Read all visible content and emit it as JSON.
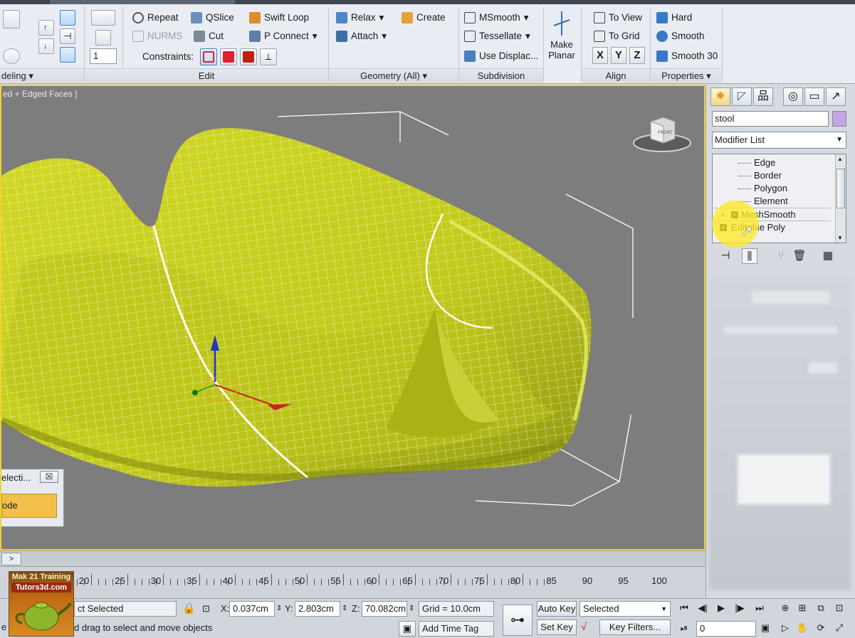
{
  "ribbon": {
    "mode_tab": "deling",
    "groups": {
      "edit": "Edit",
      "geometry": "Geometry (All)",
      "subdivision": "Subdivision",
      "align": "Align",
      "properties": "Properties"
    },
    "edit": {
      "repeat": "Repeat",
      "qslice": "QSlice",
      "swift_loop": "Swift Loop",
      "nurms": "NURMS",
      "cut": "Cut",
      "p_connect": "P Connect",
      "constraints": "Constraints:"
    },
    "geometry": {
      "relax": "Relax",
      "create": "Create",
      "attach": "Attach"
    },
    "subdivision": {
      "msmooth": "MSmooth",
      "tessellate": "Tessellate",
      "use_displac": "Use Displac..."
    },
    "make_planar": "Make Planar",
    "make_planar_l1": "Make",
    "make_planar_l2": "Planar",
    "align": {
      "to_view": "To View",
      "to_grid": "To Grid",
      "x": "X",
      "y": "Y",
      "z": "Z"
    },
    "properties": {
      "hard": "Hard",
      "smooth": "Smooth",
      "smooth30": "Smooth 30"
    },
    "spinner_value": "1"
  },
  "viewport": {
    "label": "ed + Edged Faces ]",
    "viewcube_face": "FRONT"
  },
  "selection_panel": {
    "title": "electi...",
    "close": "☒",
    "mode": "ode"
  },
  "command_panel": {
    "object_name": "stool",
    "object_color": "#c7a6e8",
    "modifier_list": "Modifier List",
    "subobjects": [
      "Edge",
      "Border",
      "Polygon",
      "Element"
    ],
    "modifiers": [
      "MeshSmooth",
      "Editable Poly"
    ],
    "highlight_color": "#ffeb28"
  },
  "timeline": {
    "next_button": ">",
    "ticks": [
      "20",
      "25",
      "30",
      "35",
      "40",
      "45",
      "50",
      "55",
      "60",
      "65",
      "70",
      "75",
      "80",
      "85",
      "90",
      "95",
      "100"
    ]
  },
  "status": {
    "selection": "ct Selected",
    "prompt": "d drag to select and move objects",
    "x_label": "X:",
    "x_value": "0.037cm",
    "y_label": "Y:",
    "y_value": "2.803cm",
    "z_label": "Z:",
    "z_value": "70.082cm",
    "grid": "Grid = 10.0cm",
    "add_time_tag": "Add Time Tag",
    "auto_key": "Auto Key",
    "set_key": "Set Key",
    "key_mode": "Selected",
    "key_filters": "Key Filters...",
    "frame": "0",
    "left_edge": "e"
  },
  "logo": {
    "line1": "Mak 21 Training",
    "line2": "Tutors3d.com"
  },
  "colors": {
    "accent": "#f0d234",
    "mesh": "#c8d21e",
    "viewport_bg": "#7d7d7d"
  }
}
